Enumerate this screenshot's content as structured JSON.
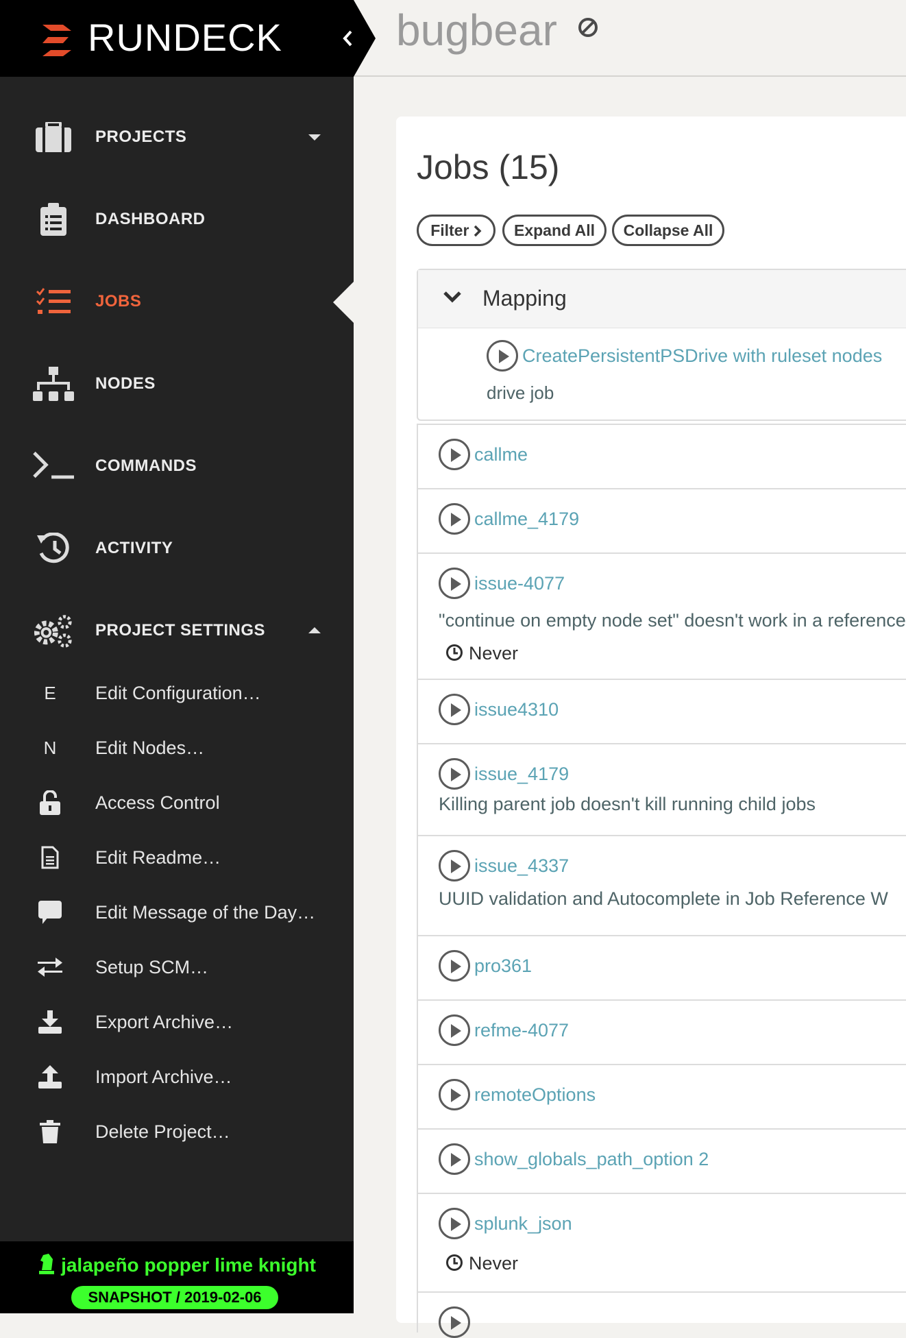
{
  "brand": {
    "name": "RUNDECK"
  },
  "project": {
    "name": "bugbear"
  },
  "nav": {
    "projects": "PROJECTS",
    "dashboard": "DASHBOARD",
    "jobs": "JOBS",
    "nodes": "NODES",
    "commands": "COMMANDS",
    "activity": "ACTIVITY",
    "project_settings": "PROJECT SETTINGS"
  },
  "settings_menu": [
    {
      "icon": "E",
      "label": "Edit Configuration…"
    },
    {
      "icon": "N",
      "label": "Edit Nodes…"
    },
    {
      "icon": "unlock-icon",
      "label": "Access Control"
    },
    {
      "icon": "file-icon",
      "label": "Edit Readme…"
    },
    {
      "icon": "comment-icon",
      "label": "Edit Message of the Day…"
    },
    {
      "icon": "transfer-icon",
      "label": "Setup SCM…"
    },
    {
      "icon": "download-icon",
      "label": "Export Archive…"
    },
    {
      "icon": "upload-icon",
      "label": "Import Archive…"
    },
    {
      "icon": "trash-icon",
      "label": "Delete Project…"
    }
  ],
  "footer": {
    "version_name": "jalapeño popper lime knight",
    "snapshot": "SNAPSHOT / 2019-02-06"
  },
  "jobs": {
    "title": "Jobs (15)",
    "filter": "Filter",
    "expand_all": "Expand All",
    "collapse_all": "Collapse All",
    "group": {
      "name": "Mapping",
      "job_name": "CreatePersistentPSDrive with ruleset nodes",
      "job_desc": "drive job"
    },
    "list": [
      {
        "name": "callme"
      },
      {
        "name": "callme_4179"
      },
      {
        "name": "issue-4077",
        "desc": "\"continue on empty node set\" doesn't work in a reference",
        "schedule": "Never"
      },
      {
        "name": "issue4310"
      },
      {
        "name": "issue_4179",
        "desc": "Killing parent job doesn't kill running child jobs"
      },
      {
        "name": "issue_4337",
        "desc": "UUID validation and Autocomplete in Job Reference W"
      },
      {
        "name": "pro361"
      },
      {
        "name": "refme-4077"
      },
      {
        "name": "remoteOptions"
      },
      {
        "name": "show_globals_path_option 2"
      },
      {
        "name": "splunk_json",
        "schedule": "Never"
      }
    ]
  },
  "colors": {
    "accent": "#f0643c",
    "link": "#5ba3b4",
    "sidebar": "#232323",
    "snapshot": "#3cff2c"
  }
}
